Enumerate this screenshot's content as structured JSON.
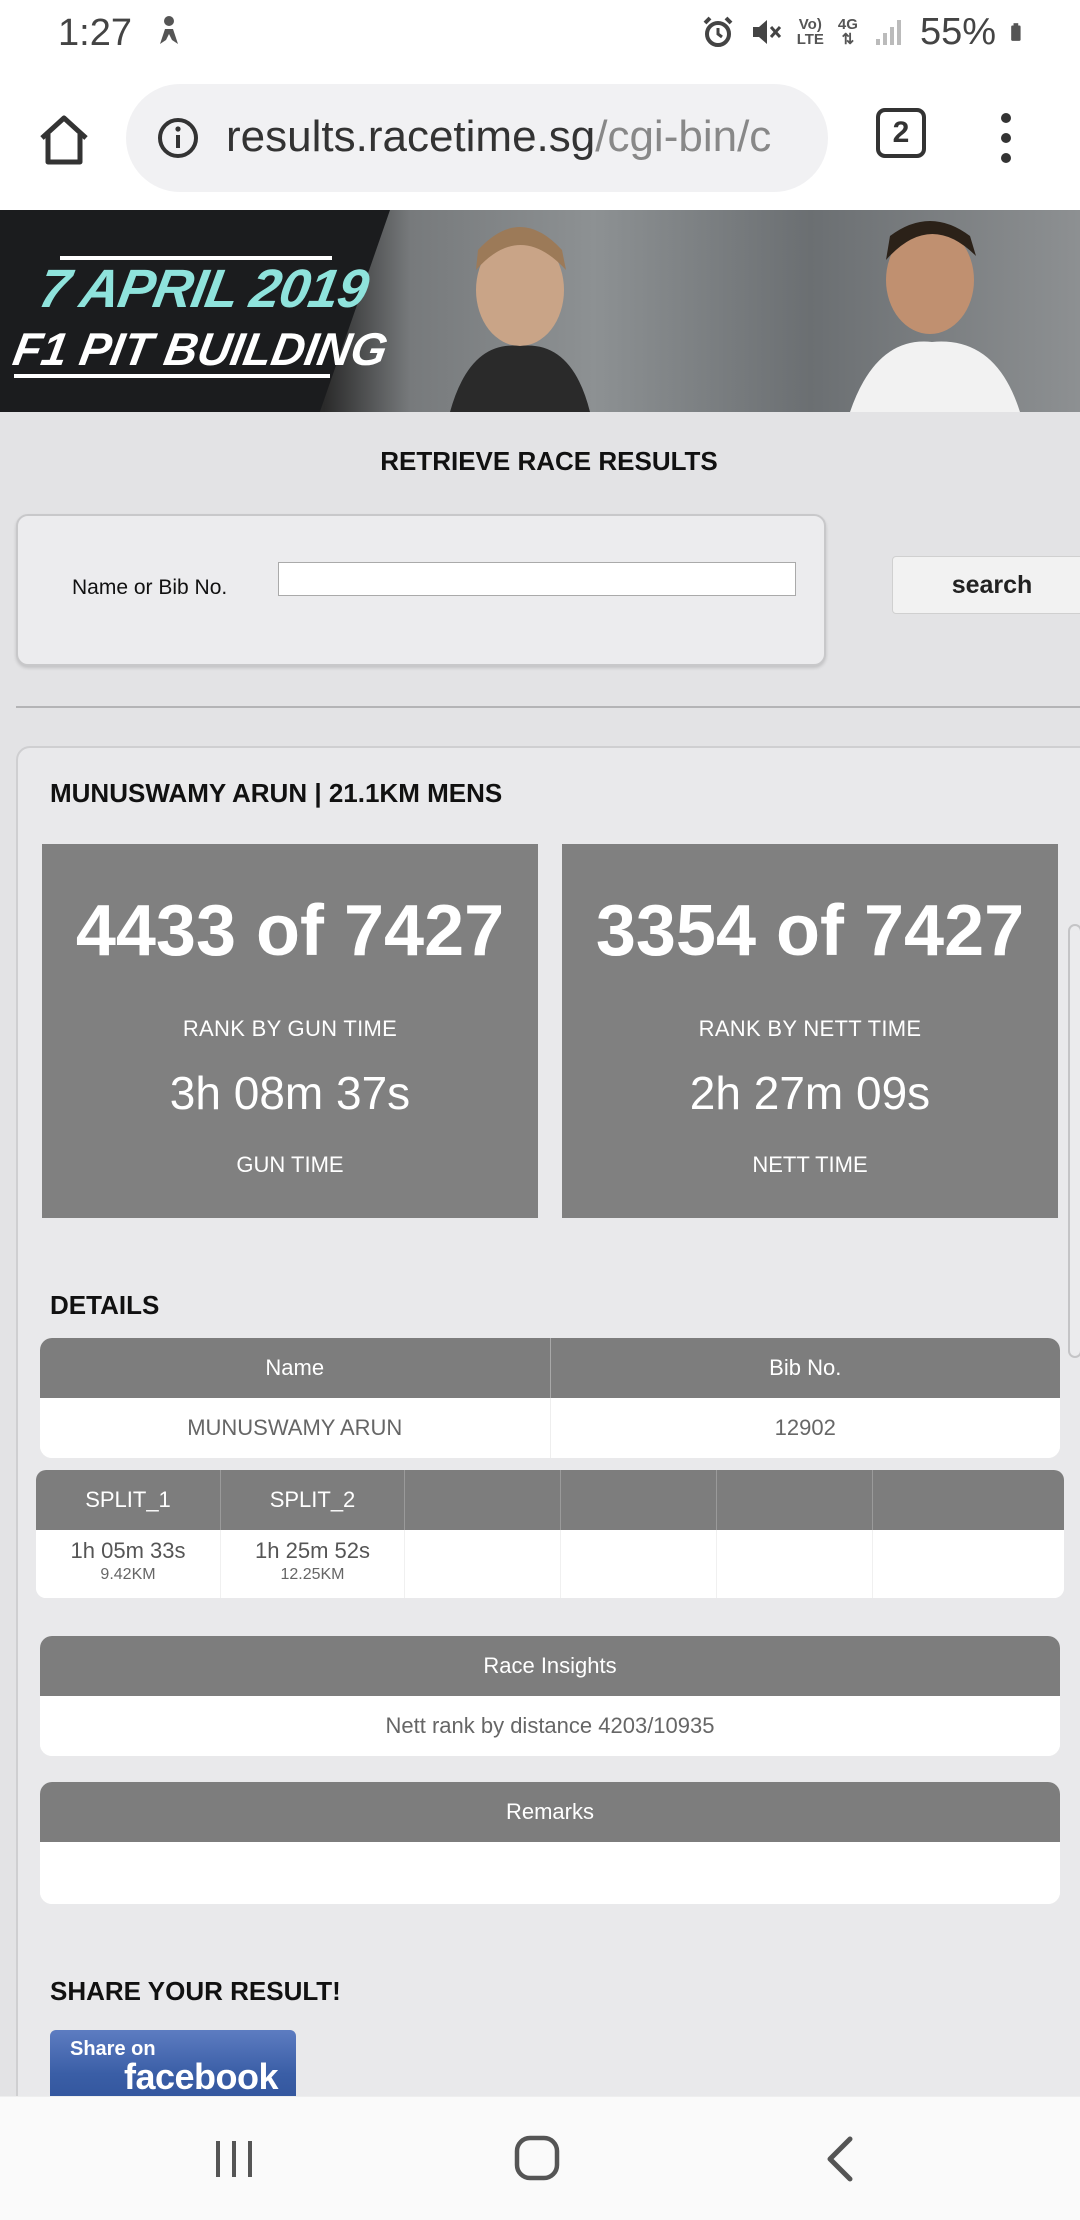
{
  "status_bar": {
    "time": "1:27",
    "network_top": "Vo)",
    "network_bottom": "LTE",
    "data_type": "4G",
    "battery": "55%"
  },
  "browser": {
    "url_domain": "results.racetime.sg",
    "url_path": "/cgi-bin/c",
    "tab_count": "2"
  },
  "banner": {
    "date": "7 APRIL 2019",
    "venue": "F1 PIT BUILDING"
  },
  "page": {
    "title": "RETRIEVE RACE RESULTS",
    "search": {
      "label": "Name or Bib No.",
      "value": "",
      "placeholder": "",
      "button": "search"
    }
  },
  "result": {
    "heading": "MUNUSWAMY ARUN | 21.1KM MENS",
    "gun": {
      "rank": "4433 of 7427",
      "rank_label": "RANK BY GUN TIME",
      "time": "3h 08m 37s",
      "time_label": "GUN TIME"
    },
    "nett": {
      "rank": "3354 of 7427",
      "rank_label": "RANK BY NETT TIME",
      "time": "2h 27m 09s",
      "time_label": "NETT TIME"
    },
    "details_heading": "DETAILS",
    "details": {
      "headers": [
        "Name",
        "Bib No."
      ],
      "values": [
        "MUNUSWAMY ARUN",
        "12902"
      ]
    },
    "splits": {
      "headers": [
        "SPLIT_1",
        "SPLIT_2",
        "",
        "",
        "",
        ""
      ],
      "times": [
        "1h 05m 33s",
        "1h 25m 52s"
      ],
      "distances": [
        "9.42KM",
        "12.25KM"
      ]
    },
    "insights": {
      "header": "Race Insights",
      "value": "Nett rank by distance 4203/10935"
    },
    "remarks": {
      "header": "Remarks",
      "value": ""
    },
    "share_heading": "SHARE YOUR RESULT!",
    "facebook": {
      "small": "Share on",
      "big": "facebook"
    }
  },
  "colors": {
    "panel_gray": "#808080",
    "page_bg": "#e3e3e5",
    "facebook_blue": "#3b5998"
  }
}
